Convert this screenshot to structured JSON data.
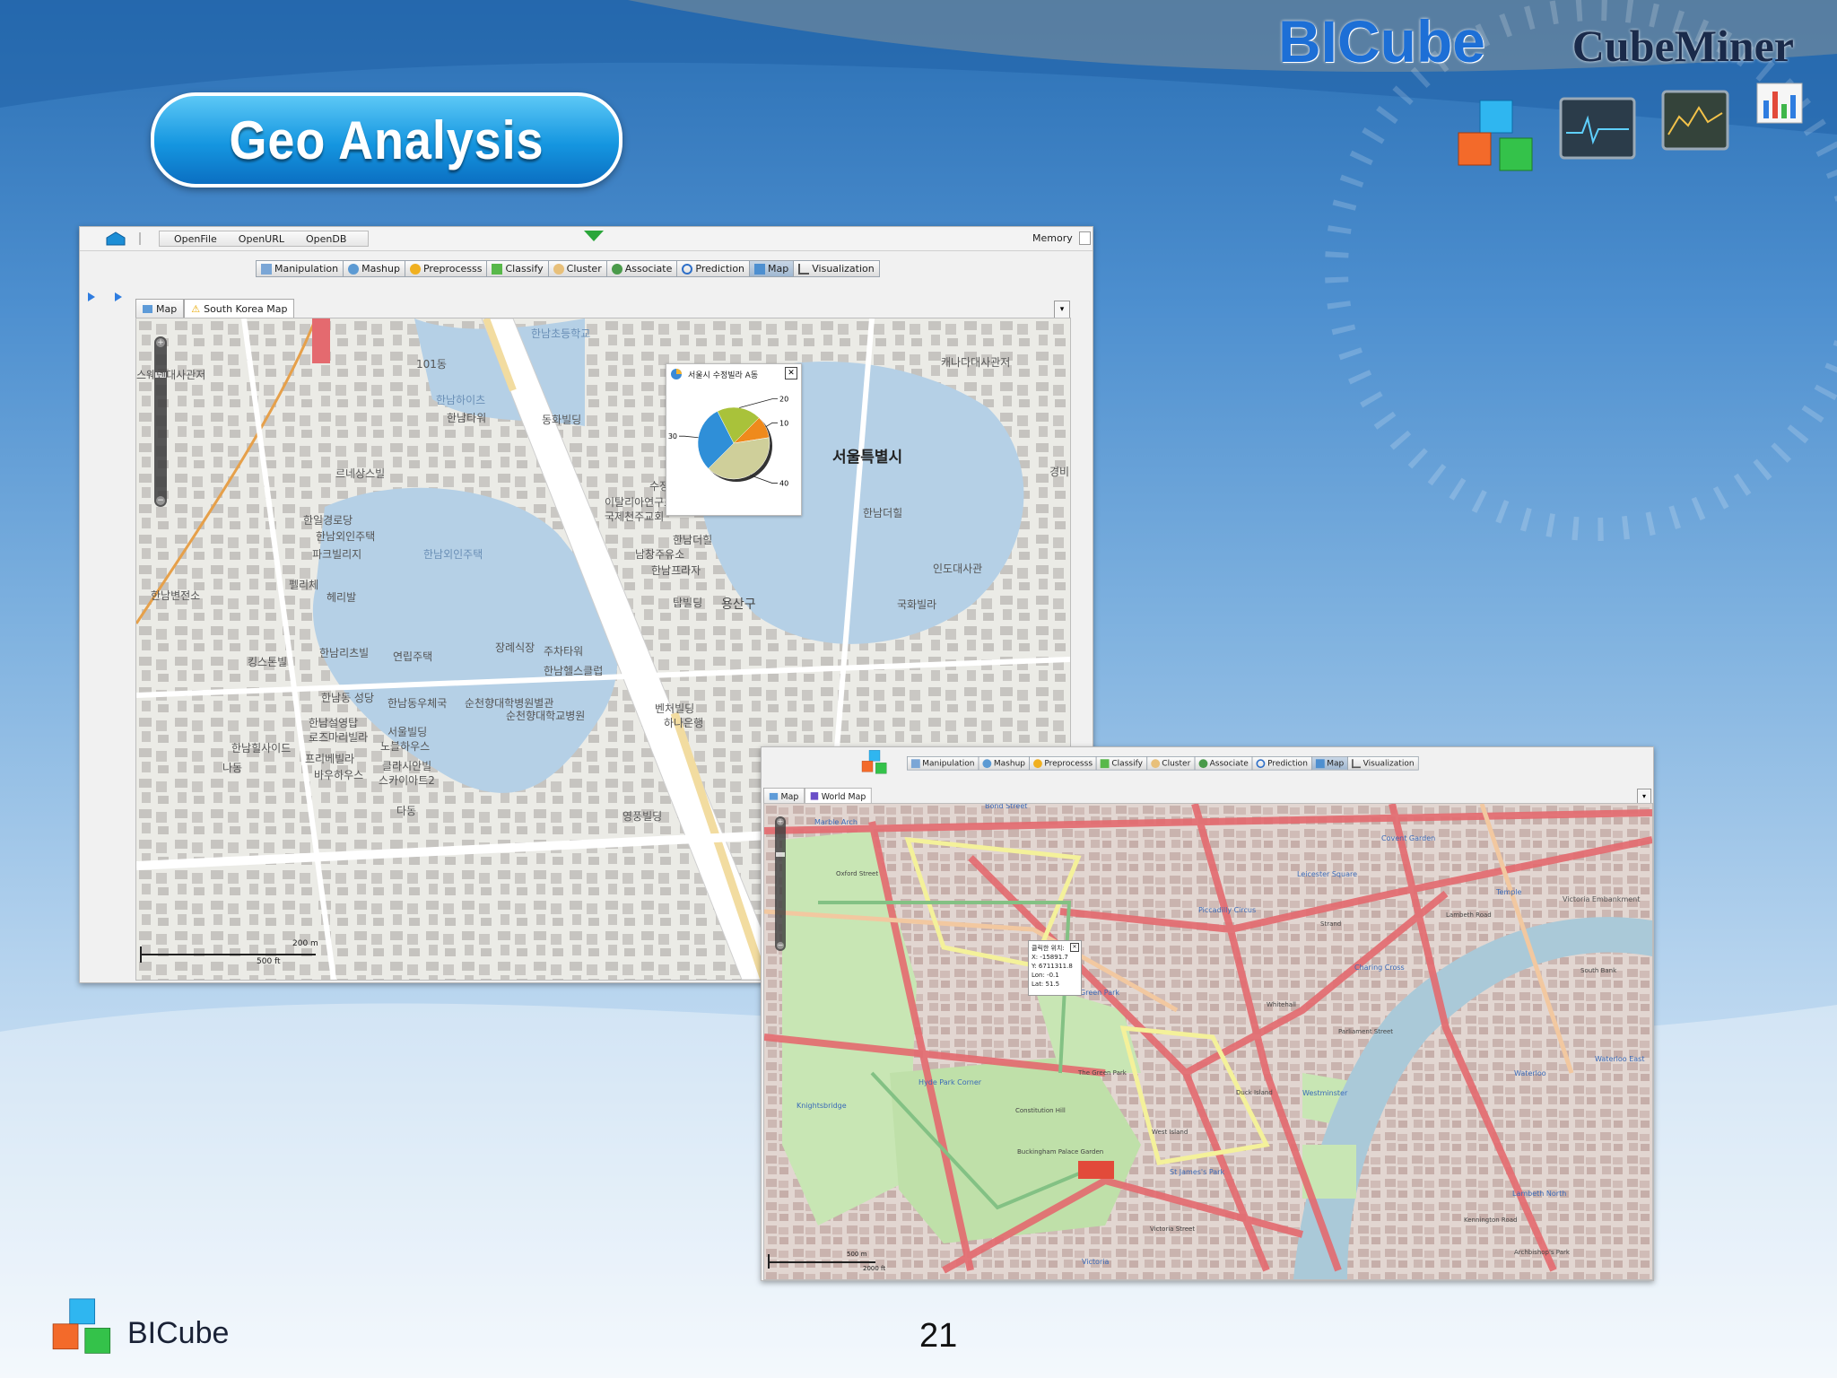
{
  "slide": {
    "title": "Geo Analysis",
    "brand_main": "BICube",
    "brand_product": "CubeMiner",
    "footer_brand": "BICube",
    "page_number": "21"
  },
  "window1": {
    "menu": [
      "OpenFile",
      "OpenURL",
      "OpenDB"
    ],
    "memory_label": "Memory",
    "toolbar": [
      "Manipulation",
      "Mashup",
      "Preprocesss",
      "Classify",
      "Cluster",
      "Associate",
      "Prediction",
      "Map",
      "Visualization"
    ],
    "active_tool": "Map",
    "tabs": [
      "Map",
      "South Korea Map"
    ],
    "chart_popup_title": "서울시 수정빌라 A동",
    "map_center_label": "서울특별시",
    "scale": {
      "metric": "200 m",
      "imperial": "500 ft"
    },
    "labels": [
      "한남초등학교",
      "101동",
      "캐나다대사관저",
      "스웨덴대사관저",
      "한남하이츠",
      "한남타워",
      "동화빌딩",
      "르네상스빌",
      "한일경로당",
      "한남외인주택",
      "파크빌리지",
      "한남외인주택",
      "수정빌라A동",
      "이탈리아연구소",
      "국제천주교회",
      "한남더힐",
      "남창주유소",
      "한남프라자",
      "인도대사관",
      "한남변전소",
      "펠리체",
      "헤리발",
      "탑빌딩",
      "용산구",
      "국화빌라",
      "장례식장",
      "주차타워",
      "한남리츠빌",
      "연립주택",
      "킹스톤빌",
      "한남헬스클럽",
      "한남동 성당",
      "한남동우체국",
      "순천향대학병원별관",
      "순천향대학교병원",
      "벤처빌딩",
      "하나은행",
      "한남설영탑",
      "로즈마리빌라",
      "서울빌딩",
      "노블하우스",
      "한남힐사이드",
      "나동",
      "프리베빌라",
      "바우하우스",
      "클라시안빌",
      "스카이아트2",
      "다동",
      "영풍빌딩",
      "경비",
      "한남더힐"
    ]
  },
  "window2": {
    "toolbar": [
      "Manipulation",
      "Mashup",
      "Preprocesss",
      "Classify",
      "Cluster",
      "Associate",
      "Prediction",
      "Map",
      "Visualization"
    ],
    "active_tool": "Map",
    "tabs": [
      "Map",
      "World Map"
    ],
    "popup": {
      "title": "클릭한 위치:",
      "x": "X: -15891.7",
      "y": "Y: 6711311.8",
      "lon": "Lon: -0.1",
      "lat": "Lat: 51.5"
    },
    "scale": {
      "metric": "500 m",
      "imperial": "2000 ft"
    },
    "labels": [
      "Bond Street",
      "Covent Garden",
      "Leicester Square",
      "Piccadilly Circus",
      "Charing Cross",
      "St James's Park",
      "Hyde Park Corner",
      "Green Park",
      "Knightsbridge",
      "Victoria",
      "Westminster",
      "Waterloo",
      "Lambeth North",
      "Victoria Embankment",
      "Temple",
      "Waterloo East",
      "Marble Arch",
      "Buckingham Palace Garden",
      "The Green Park",
      "Duck Island",
      "West Island",
      "Victoria Street",
      "South Bank",
      "Lambeth Road",
      "Parliament Street",
      "Kennington Road",
      "Archbishop's Park",
      "Constitution Hill",
      "Oxford Street",
      "Strand",
      "Whitehall"
    ]
  },
  "chart_data": {
    "type": "pie",
    "title": "서울시 수정빌라 A동",
    "values": [
      30,
      20,
      10,
      40
    ],
    "tick_labels": [
      "30",
      "20",
      "10",
      "40"
    ],
    "colors": [
      "#2f8fd8",
      "#a9c23a",
      "#ef8a1c",
      "#cfcf9a"
    ]
  },
  "colors": {
    "accent": "#1596e0",
    "brand_blue": "#1d6fd6",
    "water": "#b5d0e6",
    "map_bg": "#ebebe6",
    "road_major": "#e46a6f",
    "park": "#c8e6b4"
  }
}
